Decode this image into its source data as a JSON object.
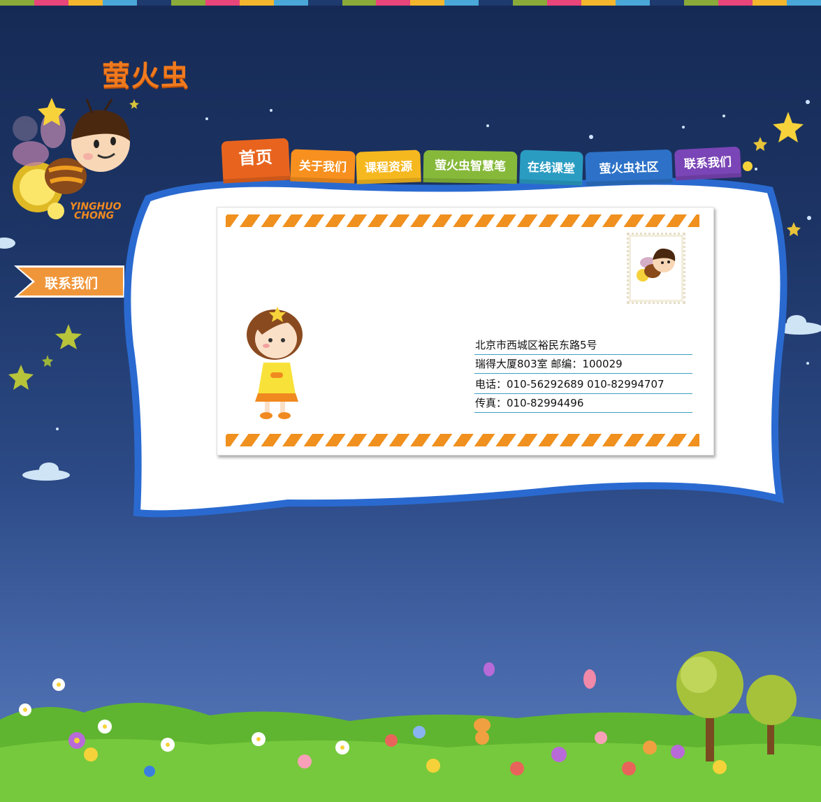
{
  "top_strip_colors": [
    "#8aaa3a",
    "#e8457a",
    "#f4b62c",
    "#4aa8d8",
    "#1e3a6e",
    "#8aaa3a",
    "#e8457a",
    "#f4b62c",
    "#4aa8d8",
    "#1e3a6e",
    "#8aaa3a",
    "#e8457a",
    "#f4b62c",
    "#4aa8d8",
    "#1e3a6e",
    "#8aaa3a",
    "#e8457a",
    "#f4b62c",
    "#4aa8d8",
    "#1e3a6e",
    "#8aaa3a",
    "#e8457a",
    "#f4b62c",
    "#4aa8d8"
  ],
  "brand": {
    "logo_text": "萤火虫",
    "mascot_caption_line1": "YINGHUO",
    "mascot_caption_line2": "CHONG"
  },
  "sidebar": {
    "contact_label": "联系我们",
    "contact_color": "#f0963a"
  },
  "nav": {
    "tabs": [
      {
        "label": "首页",
        "color": "#e8641e"
      },
      {
        "label": "关于我们",
        "color": "#f7901e"
      },
      {
        "label": "课程资源",
        "color": "#f5b81f"
      },
      {
        "label": "萤火虫智慧笔",
        "color": "#86b93a"
      },
      {
        "label": "在线课堂",
        "color": "#2a9cc2"
      },
      {
        "label": "萤火虫社区",
        "color": "#2d72c8"
      },
      {
        "label": "联系我们",
        "color": "#7a45b6"
      }
    ]
  },
  "contact": {
    "address_line1": "北京市西城区裕民东路5号",
    "address_line2": "瑞得大厦803室    邮编：100029",
    "phone_line": "电话：010-56292689  010-82994707",
    "fax_line": "传真：010-82994496"
  }
}
